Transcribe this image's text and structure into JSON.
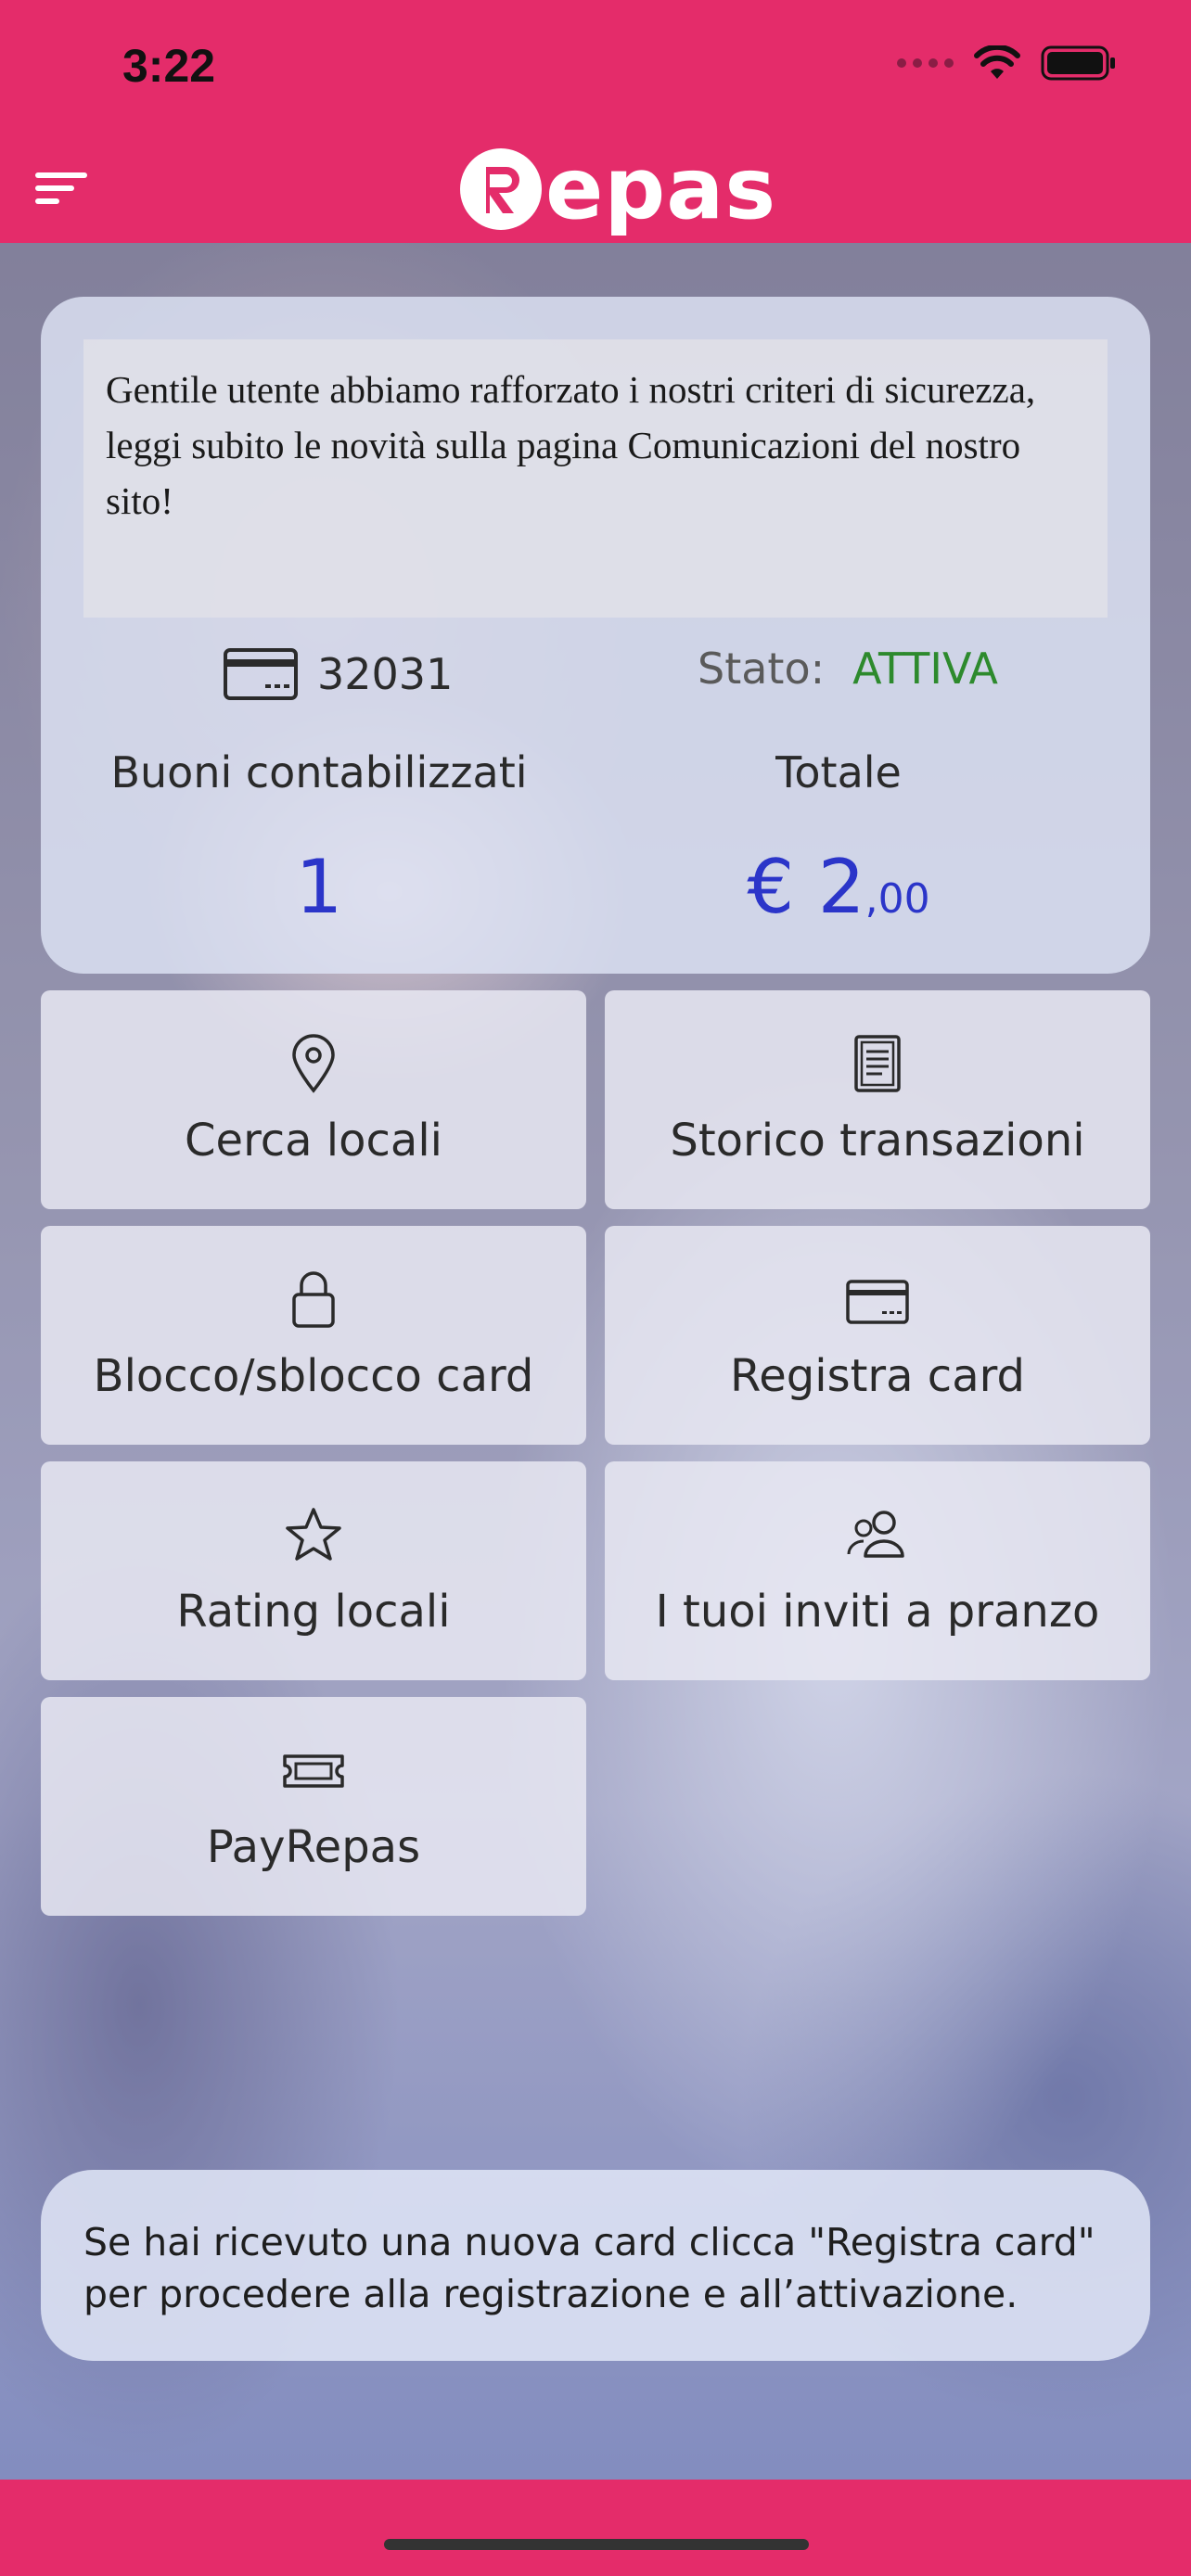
{
  "status_bar": {
    "time": "3:22"
  },
  "header": {
    "logo_text": "epas",
    "logo_letter": "R"
  },
  "card": {
    "notice": "Gentile utente abbiamo rafforzato i nostri criteri di sicurezza, leggi subito le novità sulla pagina Comunicazioni del nostro sito!",
    "card_number": "32031",
    "status_label": "Stato:",
    "status_value": "ATTIVA",
    "vouchers_label": "Buoni contabilizzati",
    "vouchers_value": "1",
    "total_label": "Totale",
    "total_currency_int": "€ 2",
    "total_decimals": ",00",
    "colors": {
      "status_active": "#2d8a2d",
      "value_blue": "#2b35c9"
    }
  },
  "tiles": [
    {
      "label": "Cerca locali",
      "icon": "map-pin-icon"
    },
    {
      "label": "Storico transazioni",
      "icon": "document-icon"
    },
    {
      "label": "Blocco/sblocco card",
      "icon": "lock-icon"
    },
    {
      "label": "Registra card",
      "icon": "credit-card-icon"
    },
    {
      "label": "Rating locali",
      "icon": "star-icon"
    },
    {
      "label": "I tuoi inviti a pranzo",
      "icon": "users-icon"
    },
    {
      "label": "PayRepas",
      "icon": "ticket-icon"
    }
  ],
  "info": {
    "text": "Se hai ricevuto una nuova card clicca \"Registra card\" per procedere alla registrazione e all’attivazione."
  },
  "theme": {
    "brand": "#e42c6a"
  }
}
